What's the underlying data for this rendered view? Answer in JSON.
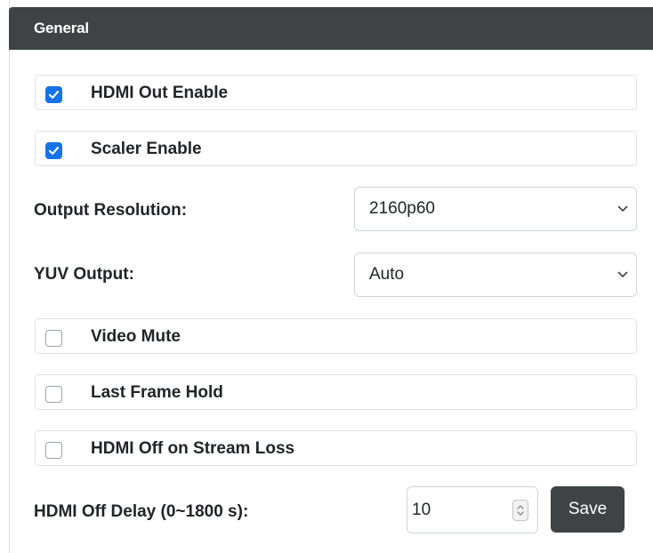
{
  "card": {
    "header_title": "General"
  },
  "checkboxes": [
    {
      "label": "HDMI Out Enable",
      "checked": true
    },
    {
      "label": "Scaler Enable",
      "checked": true
    },
    {
      "label": "Video Mute",
      "checked": false
    },
    {
      "label": "Last Frame Hold",
      "checked": false
    },
    {
      "label": "HDMI Off on Stream Loss",
      "checked": false
    }
  ],
  "output_resolution": {
    "label": "Output Resolution:",
    "value": "2160p60"
  },
  "yuv_output": {
    "label": "YUV Output:",
    "value": "Auto"
  },
  "hdmi_off_delay": {
    "label": "HDMI Off Delay (0~1800 s):",
    "value": "10"
  },
  "save_label": "Save",
  "colors": {
    "header_bg": "#3f4346",
    "accent_checked": "#1473e6",
    "button_bg": "#3f4346"
  }
}
